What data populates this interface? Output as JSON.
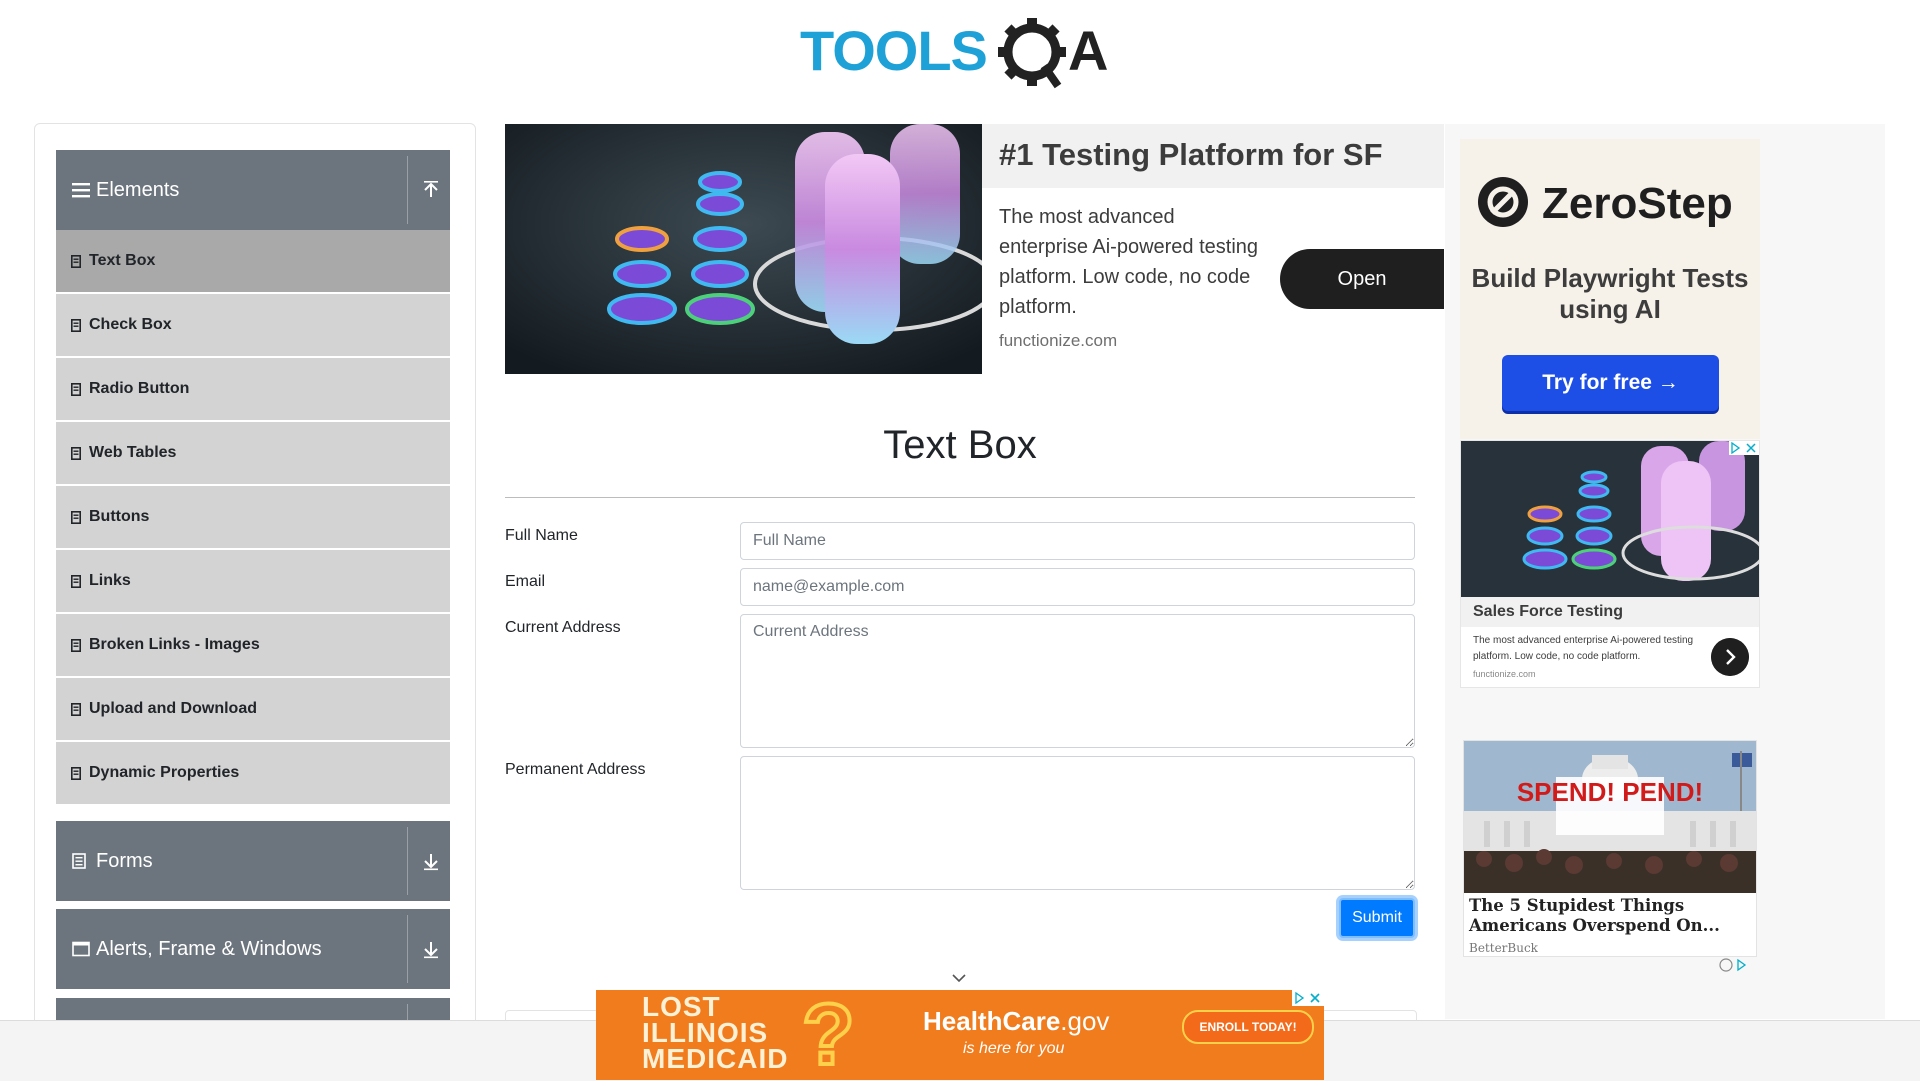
{
  "header": {
    "logo_text": "TOOLSQA"
  },
  "sidebar": {
    "groups": [
      {
        "label": "Elements",
        "icon": "hamburger-icon",
        "state": "expanded"
      },
      {
        "label": "Forms",
        "icon": "document-icon",
        "state": "collapsed"
      },
      {
        "label": "Alerts, Frame & Windows",
        "icon": "window-icon",
        "state": "collapsed"
      }
    ],
    "items": [
      {
        "label": "Text Box",
        "active": true
      },
      {
        "label": "Check Box"
      },
      {
        "label": "Radio Button"
      },
      {
        "label": "Web Tables"
      },
      {
        "label": "Buttons"
      },
      {
        "label": "Links"
      },
      {
        "label": "Broken Links - Images"
      },
      {
        "label": "Upload and Download"
      },
      {
        "label": "Dynamic Properties"
      }
    ]
  },
  "top_ad": {
    "title": "#1 Testing Platform for SF",
    "body": "The most advanced enterprise Ai-powered testing platform. Low code, no code platform.",
    "domain": "functionize.com",
    "cta": "Open"
  },
  "main": {
    "title": "Text Box",
    "fields": {
      "full_name": {
        "label": "Full Name",
        "placeholder": "Full Name",
        "value": ""
      },
      "email": {
        "label": "Email",
        "placeholder": "name@example.com",
        "value": ""
      },
      "current_address": {
        "label": "Current Address",
        "placeholder": "Current Address",
        "value": ""
      },
      "permanent_address": {
        "label": "Permanent Address",
        "placeholder": "",
        "value": ""
      }
    },
    "submit_label": "Submit"
  },
  "right_ads": {
    "zerostep": {
      "brand": "ZeroStep",
      "tagline": "Build Playwright Tests using AI",
      "cta": "Try for free →"
    },
    "salesforce": {
      "title": "Sales Force Testing",
      "body": "The most advanced enterprise Ai-powered testing platform. Low code, no code platform.",
      "domain": "functionize.com"
    },
    "betterbuck": {
      "image_text": "SPEND! PEND!",
      "title": "The 5 Stupidest Things Americans Overspend On...",
      "source": "BetterBuck"
    }
  },
  "bottom_banner": {
    "headline": "LOST ILLINOIS MEDICAID",
    "brand": "HealthCare",
    "brand_suffix": ".gov",
    "tagline": "is here for you",
    "cta": "ENROLL TODAY!"
  },
  "colors": {
    "group_header": "#6c757d",
    "menu_item": "#d3d3d3",
    "menu_item_active": "#a9a9a9",
    "submit": "#007bff",
    "logo_blue": "#1ea1d7",
    "logo_dark": "#222222"
  }
}
